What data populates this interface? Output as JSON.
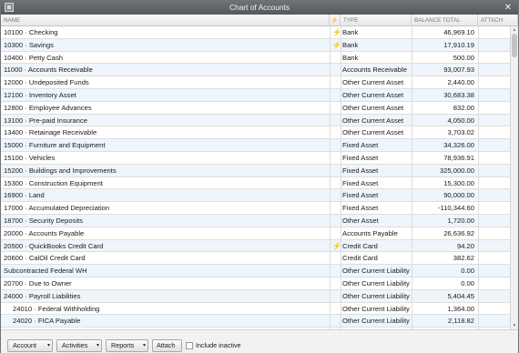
{
  "window": {
    "title": "Chart of Accounts",
    "close_symbol": "✕"
  },
  "columns": {
    "name": "NAME",
    "online": "⚡",
    "type": "TYPE",
    "balance": "BALANCE TOTAL",
    "attach": "ATTACH"
  },
  "accounts": [
    {
      "name": "10100 · Checking",
      "online": "⚡",
      "type": "Bank",
      "balance": "46,969.10"
    },
    {
      "name": "10300 · Savings",
      "online": "⚡",
      "type": "Bank",
      "balance": "17,910.19"
    },
    {
      "name": "10400 · Petty Cash",
      "online": "",
      "type": "Bank",
      "balance": "500.00"
    },
    {
      "name": "11000 · Accounts Receivable",
      "online": "",
      "type": "Accounts Receivable",
      "balance": "93,007.93"
    },
    {
      "name": "12000 · Undeposited Funds",
      "online": "",
      "type": "Other Current Asset",
      "balance": "2,440.00"
    },
    {
      "name": "12100 · Inventory Asset",
      "online": "",
      "type": "Other Current Asset",
      "balance": "30,683.38"
    },
    {
      "name": "12800 · Employee Advances",
      "online": "",
      "type": "Other Current Asset",
      "balance": "832.00"
    },
    {
      "name": "13100 · Pre-paid Insurance",
      "online": "",
      "type": "Other Current Asset",
      "balance": "4,050.00"
    },
    {
      "name": "13400 · Retainage Receivable",
      "online": "",
      "type": "Other Current Asset",
      "balance": "3,703.02"
    },
    {
      "name": "15000 · Furniture and Equipment",
      "online": "",
      "type": "Fixed Asset",
      "balance": "34,326.00"
    },
    {
      "name": "15100 · Vehicles",
      "online": "",
      "type": "Fixed Asset",
      "balance": "78,936.91"
    },
    {
      "name": "15200 · Buildings and Improvements",
      "online": "",
      "type": "Fixed Asset",
      "balance": "325,000.00"
    },
    {
      "name": "15300 · Construction Equipment",
      "online": "",
      "type": "Fixed Asset",
      "balance": "15,300.00"
    },
    {
      "name": "16900 · Land",
      "online": "",
      "type": "Fixed Asset",
      "balance": "90,000.00"
    },
    {
      "name": "17000 · Accumulated Depreciation",
      "online": "",
      "type": "Fixed Asset",
      "balance": "-110,344.60"
    },
    {
      "name": "18700 · Security Deposits",
      "online": "",
      "type": "Other Asset",
      "balance": "1,720.00"
    },
    {
      "name": "20000 · Accounts Payable",
      "online": "",
      "type": "Accounts Payable",
      "balance": "26,636.92"
    },
    {
      "name": "20500 · QuickBooks Credit Card",
      "online": "⚡",
      "type": "Credit Card",
      "balance": "94.20"
    },
    {
      "name": "20600 · CalOil Credit Card",
      "online": "",
      "type": "Credit Card",
      "balance": "382.62"
    },
    {
      "name": "Subcontracted Federal WH",
      "online": "",
      "type": "Other Current Liability",
      "balance": "0.00"
    },
    {
      "name": "20700 · Due to Owner",
      "online": "",
      "type": "Other Current Liability",
      "balance": "0.00"
    },
    {
      "name": "24000 · Payroll Liabilities",
      "online": "",
      "type": "Other Current Liability",
      "balance": "5,404.45"
    },
    {
      "name": "24010 · Federal Withholding",
      "online": "",
      "type": "Other Current Liability",
      "balance": "1,364.00",
      "sub": true
    },
    {
      "name": "24020 · FICA Payable",
      "online": "",
      "type": "Other Current Liability",
      "balance": "2,118.82",
      "sub": true
    }
  ],
  "toolbar": {
    "account": "Account",
    "activities": "Activities",
    "reports": "Reports",
    "attach": "Attach",
    "include_inactive": "Include inactive",
    "dropdown_symbol": "▾"
  }
}
